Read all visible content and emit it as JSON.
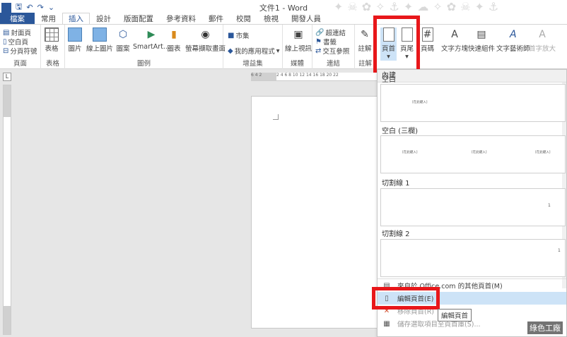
{
  "window": {
    "title": "文件1 - Word"
  },
  "qat": {
    "save": "🖫",
    "undo": "↶",
    "redo": "↷",
    "more": "⌄"
  },
  "tabs": [
    "檔案",
    "常用",
    "插入",
    "設計",
    "版面配置",
    "參考資料",
    "郵件",
    "校閱",
    "檢視",
    "開發人員"
  ],
  "ribbon": {
    "pages": {
      "cover": "封面頁",
      "blank": "空白頁",
      "break": "分頁符號",
      "label": "頁面"
    },
    "tables": {
      "table": "表格",
      "label": "表格"
    },
    "illustrations": {
      "picture": "圖片",
      "online_picture": "線上圖片",
      "shapes": "圖案",
      "smartart": "SmartArt...",
      "chart": "圖表",
      "screenshot": "螢幕擷取畫面",
      "label": "圖例"
    },
    "addins": {
      "store": "市集",
      "my_apps": "我的應用程式",
      "label": "增益集"
    },
    "media": {
      "online_video": "線上視訊",
      "label": "媒體"
    },
    "links": {
      "hyperlink": "超連結",
      "bookmark": "書籤",
      "cross_ref": "交互參照",
      "label": "連結"
    },
    "comments": {
      "comment": "註解",
      "label": "註解"
    },
    "header_footer": {
      "header": "頁首",
      "footer": "頁尾",
      "page_number": "頁碼"
    },
    "text": {
      "textbox": "文字方塊",
      "quick_parts": "快速組件",
      "wordart": "文字藝術師",
      "dropcap": "首字放大"
    }
  },
  "ruler": {
    "left_ticks": "6  4  2",
    "right_ticks": "2  4  6  8  10  12  14  16  18  20  22",
    "corner": "L"
  },
  "gallery": {
    "section": "內建",
    "items": [
      {
        "name": "空白",
        "placeholders": [
          "[在此鍵入]"
        ]
      },
      {
        "name": "空白 (三欄)",
        "placeholders": [
          "[在此鍵入]",
          "[在此鍵入]",
          "[在此鍵入]"
        ]
      },
      {
        "name": "切割線 1",
        "placeholders": [
          "1"
        ]
      },
      {
        "name": "切割線 2",
        "placeholders": [
          "1"
        ]
      }
    ],
    "menu": {
      "more": "來自於 Office.com 的其他頁首(M)",
      "edit": "編輯頁首(E)",
      "remove": "移除頁首(R)",
      "save": "儲存選取項目至頁首庫(S)..."
    },
    "tooltip": "編輯頁首"
  },
  "watermark": "綠色工廠",
  "colors": {
    "accent": "#2b579a",
    "highlight": "#e8171a"
  }
}
